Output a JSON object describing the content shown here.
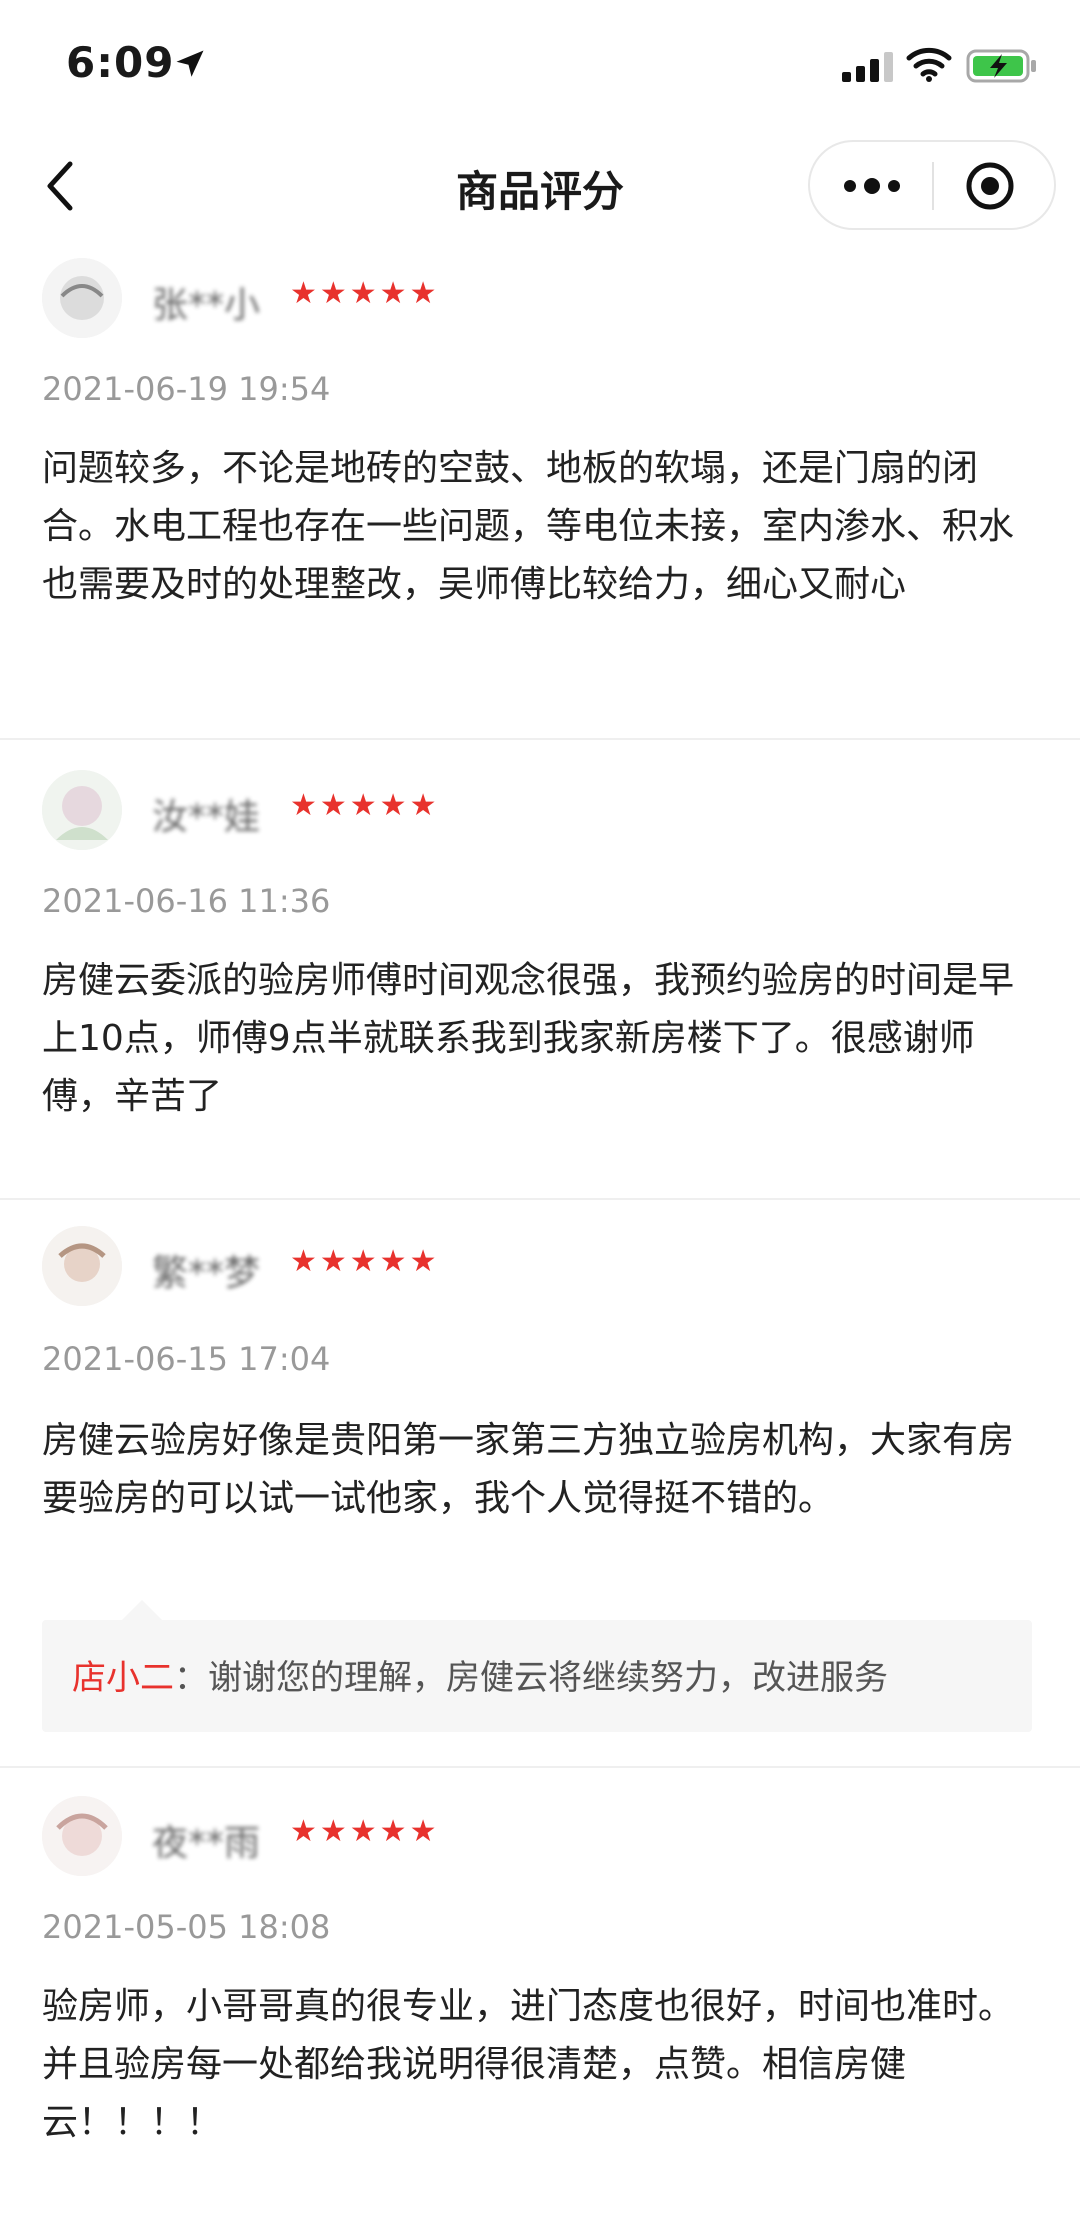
{
  "status_bar": {
    "time": "6:09"
  },
  "nav": {
    "title": "商品评分"
  },
  "reviews": [
    {
      "username": "张**小",
      "stars": "★★★★★",
      "rating": 5,
      "date": "2021-06-19 19:54",
      "content": "问题较多，不论是地砖的空鼓、地板的软塌，还是门扇的闭合。水电工程也存在一些问题，等电位未接，室内渗水、积水也需要及时的处理整改，吴师傅比较给力，细心又耐心"
    },
    {
      "username": "汝**娃",
      "stars": "★★★★★",
      "rating": 5,
      "date": "2021-06-16 11:36",
      "content": "房健云委派的验房师傅时间观念很强，我预约验房的时间是早上10点，师傅9点半就联系我到我家新房楼下了。很感谢师傅，辛苦了"
    },
    {
      "username": "繁**梦",
      "stars": "★★★★★",
      "rating": 5,
      "date": "2021-06-15 17:04",
      "content": "房健云验房好像是贵阳第一家第三方独立验房机构，大家有房要验房的可以试一试他家，我个人觉得挺不错的。",
      "reply_author": "店小二",
      "reply_sep": "：",
      "reply_text": "谢谢您的理解，房健云将继续努力，改进服务"
    },
    {
      "username": "夜**雨",
      "stars": "★★★★★",
      "rating": 5,
      "date": "2021-05-05 18:08",
      "content": "验房师，小哥哥真的很专业，进门态度也很好，时间也准时。并且验房每一处都给我说明得很清楚，点赞。相信房健云！！！！"
    }
  ]
}
